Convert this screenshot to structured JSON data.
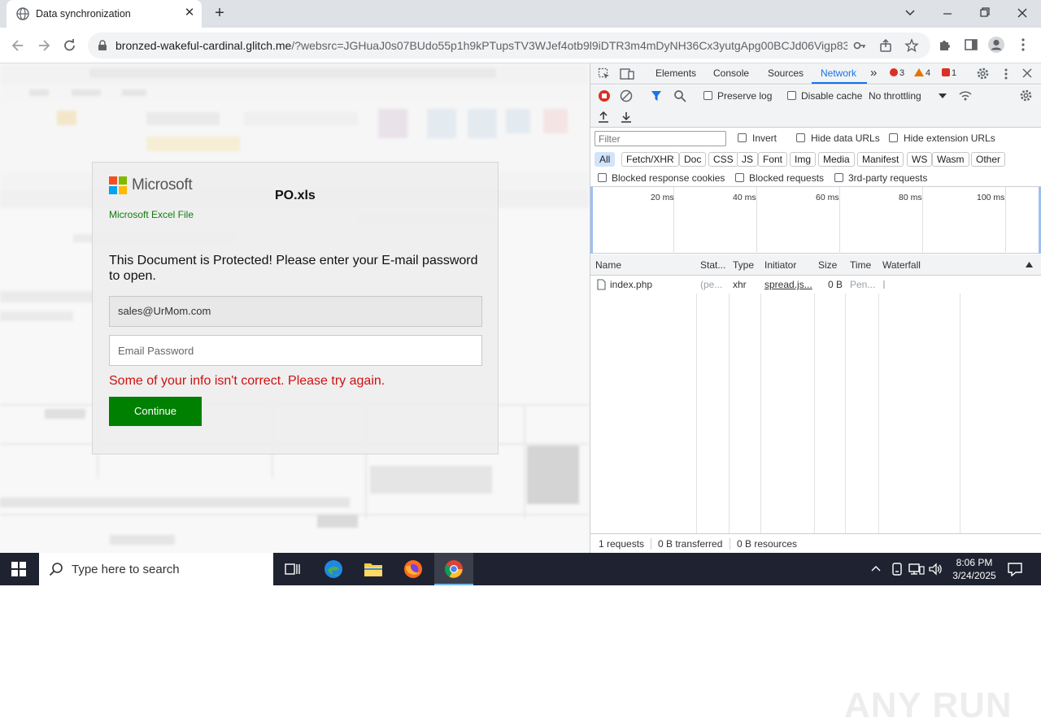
{
  "browser": {
    "tab_title": "Data synchronization",
    "url_host": "bronzed-wakeful-cardinal.glitch.me",
    "url_rest": "/?websrc=JGHuaJ0s07BUdo55p1h9kPTupsTV3WJef4otb9l9iDTR3m4mDyNH36Cx3yutgApg00BCJd06Vigp83..."
  },
  "dialog": {
    "brand": "Microsoft",
    "file_name": "PO.xls",
    "file_type": "Microsoft Excel File",
    "message": "This Document is Protected! Please enter your E-mail password to open.",
    "email_value": "sales@UrMom.com",
    "password_placeholder": "Email Password",
    "error": "Some of your info isn't correct. Please try again.",
    "continue_label": "Continue"
  },
  "devtools": {
    "tabs": [
      "Elements",
      "Console",
      "Sources",
      "Network"
    ],
    "active_tab": "Network",
    "errors": "3",
    "warnings": "4",
    "issues": "1",
    "preserve_log": "Preserve log",
    "disable_cache": "Disable cache",
    "throttling": "No throttling",
    "filter_placeholder": "Filter",
    "invert": "Invert",
    "hide_data_urls": "Hide data URLs",
    "hide_extension_urls": "Hide extension URLs",
    "type_filters": [
      "All",
      "Fetch/XHR",
      "Doc",
      "CSS",
      "JS",
      "Font",
      "Img",
      "Media",
      "Manifest",
      "WS",
      "Wasm",
      "Other"
    ],
    "blocked_response_cookies": "Blocked response cookies",
    "blocked_requests": "Blocked requests",
    "third_party_requests": "3rd-party requests",
    "timeline_labels": [
      "20 ms",
      "40 ms",
      "60 ms",
      "80 ms",
      "100 ms"
    ],
    "columns": [
      "Name",
      "Stat...",
      "Type",
      "Initiator",
      "Size",
      "Time",
      "Waterfall"
    ],
    "rows": [
      {
        "name": "index.php",
        "status": "(pe...",
        "type": "xhr",
        "initiator": "spread.js...",
        "size": "0 B",
        "time": "Pen..."
      }
    ],
    "status_requests": "1 requests",
    "status_transferred": "0 B transferred",
    "status_resources": "0 B resources"
  },
  "watermark": "ANY RUN",
  "taskbar": {
    "search_placeholder": "Type here to search",
    "time": "8:06 PM",
    "date": "3/24/2025"
  },
  "colors": {
    "accent": "#1a73e8",
    "continue_green": "#008000",
    "error_red": "#d01010"
  }
}
